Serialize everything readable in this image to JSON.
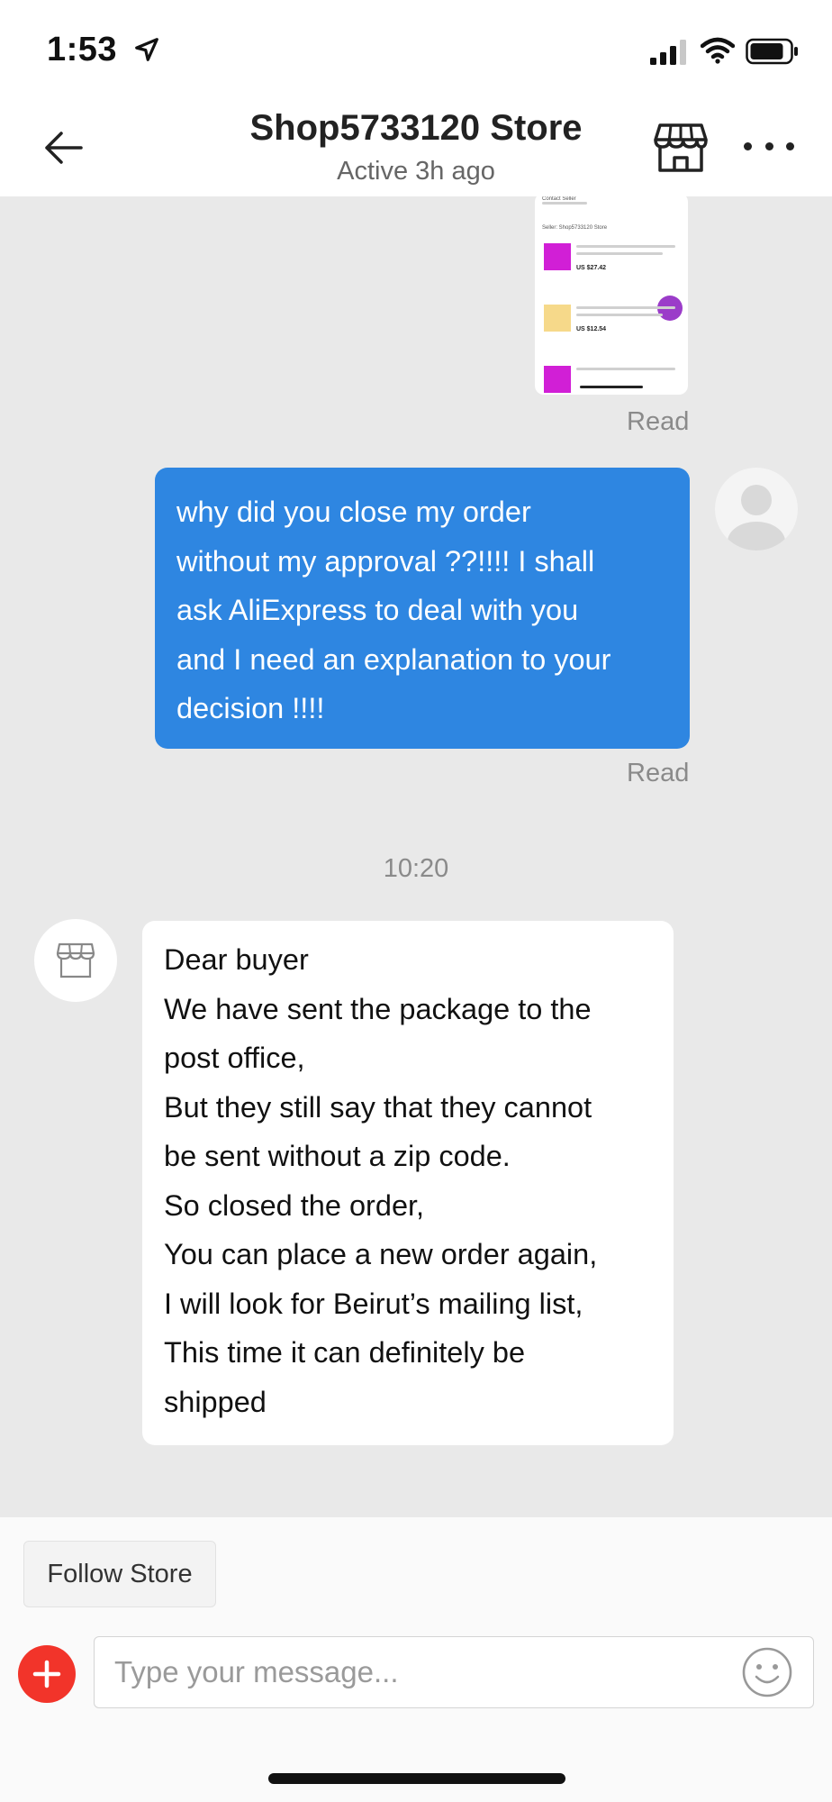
{
  "status_bar": {
    "time": "1:53",
    "icons": [
      "location-arrow-icon",
      "cellular-signal-icon",
      "wifi-icon",
      "battery-icon"
    ]
  },
  "header": {
    "title": "Shop5733120 Store",
    "subtitle": "Active 3h ago",
    "icons": [
      "back-arrow-icon",
      "store-icon",
      "more-icon"
    ]
  },
  "chat": {
    "screenshot_message": {
      "lines": [
        "Contact Seller",
        "Seller: Shop5733120 Store"
      ],
      "prices": [
        "US $27.42",
        "US $12.54"
      ],
      "status": "Read"
    },
    "outgoing_message": {
      "text": "why did you close my order\nwithout my approval ??!!!! I shall\nask AliExpress to deal with you\nand I need an explanation to your\ndecision !!!!",
      "status": "Read"
    },
    "timestamp": "10:20",
    "incoming_message": {
      "lines": [
        "Dear buyer",
        "We have sent the package to the",
        "post office,",
        "But they still say that they cannot",
        "be sent without a zip code.",
        "So closed the order,",
        "You can place a new order again,",
        "I will look for Beirut’s mailing list,",
        "This time it can definitely be",
        "shipped"
      ]
    }
  },
  "composer": {
    "follow_label": "Follow Store",
    "placeholder": "Type your message...",
    "accent_color": "#f2342a"
  },
  "colors": {
    "outgoing_bubble": "#2e86e1",
    "chat_background": "#e9e9e9"
  }
}
